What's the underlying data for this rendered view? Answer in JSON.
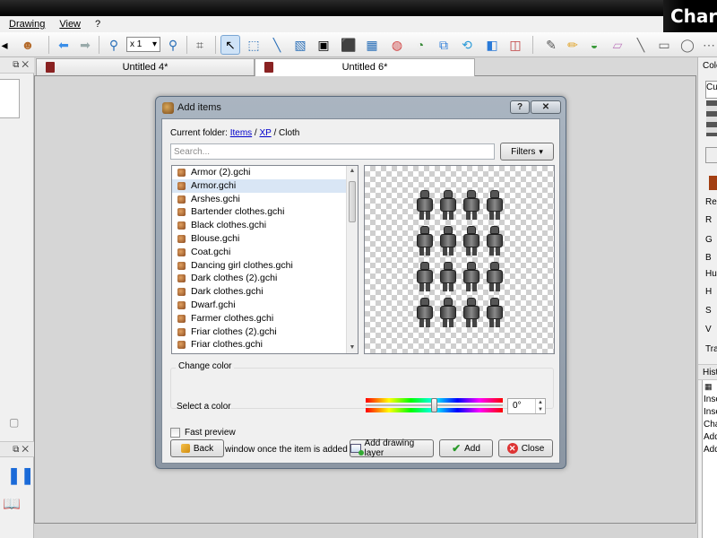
{
  "app": {
    "brand": "Char",
    "menu": [
      "Drawing",
      "View",
      "?"
    ],
    "toolbar": {
      "zoom_value": "x 1"
    },
    "tabs": [
      {
        "label": "Untitled 4*",
        "active": false
      },
      {
        "label": "Untitled 6*",
        "active": true
      }
    ],
    "right_dock": {
      "color_header": "Colo",
      "cur_label": "Cur",
      "labels": [
        "Rec",
        "R",
        "G",
        "B",
        "Hue",
        "H",
        "S",
        "V",
        "Tra"
      ],
      "history_header": "Histo",
      "history_items": [
        "Inse",
        "Inse",
        "Cha",
        "Add",
        "Add"
      ],
      "swatch_color": "#a33f12"
    }
  },
  "dialog": {
    "title": "Add items",
    "help_btn": "?",
    "close_btn": "✕",
    "current_folder_label": "Current folder:",
    "path": [
      "Items",
      "XP",
      "Cloth"
    ],
    "search_placeholder": "Search...",
    "filters_label": "Filters",
    "items": [
      "Armor (2).gchi",
      "Armor.gchi",
      "Arshes.gchi",
      "Bartender clothes.gchi",
      "Black clothes.gchi",
      "Blouse.gchi",
      "Coat.gchi",
      "Dancing girl clothes.gchi",
      "Dark clothes (2).gchi",
      "Dark clothes.gchi",
      "Dwarf.gchi",
      "Farmer clothes.gchi",
      "Friar clothes (2).gchi",
      "Friar clothes.gchi"
    ],
    "selected_index": 1,
    "change_color_title": "Change color",
    "select_color_label": "Select a color",
    "hue_value": "0°",
    "hue_position": 0.5,
    "fast_preview_label": "Fast preview",
    "close_window_label": "Close the window once the item is added",
    "back_label": "Back",
    "add_layer_label": "Add drawing layer",
    "add_label": "Add",
    "close_label": "Close"
  }
}
